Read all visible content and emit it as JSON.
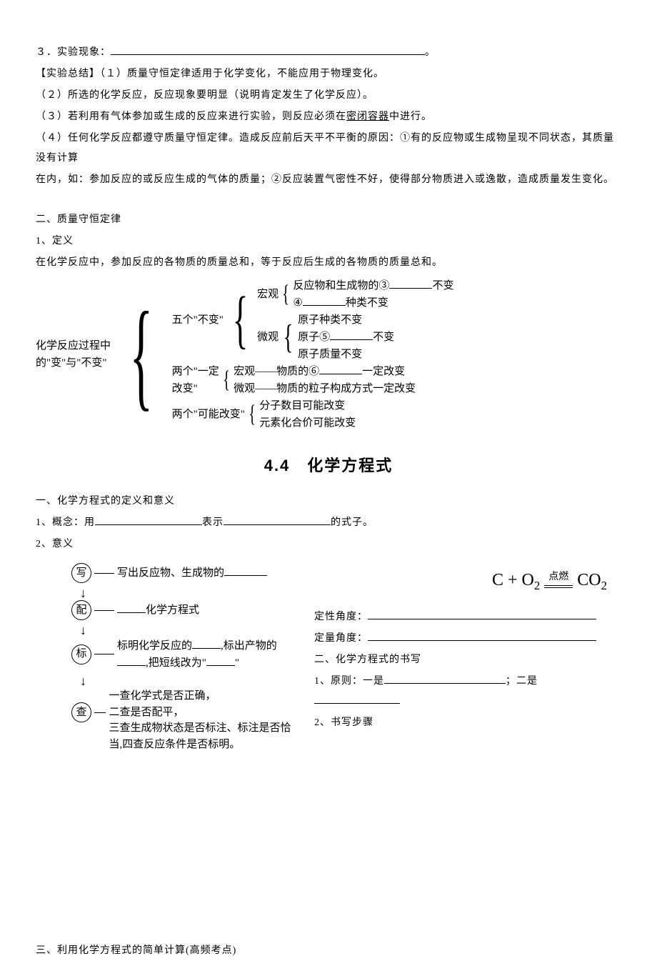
{
  "top": {
    "p3_label": "３．实验现象：",
    "p3_end": "。",
    "summary_1": "【实验总结】（１）质量守恒定律适用于化学变化，不能应用于物理变化。",
    "summary_2": "（２）所选的化学反应，反应现象要明显（说明肯定发生了化学反应）。",
    "summary_3a": "（３）若利用有气体参加或生成的反应来进行实验，则反应必须在",
    "summary_3b": "密闭容器",
    "summary_3c": "中进行。",
    "summary_4a": "（４）任何化学反应都遵守质量守恒定律。造成反应前后天平不平衡的原因：①有的反应物或生成物呈现不同状态，其质量没有计算",
    "summary_4b": "在内，如：参加反应的或反应生成的气体的质量；②反应装置气密性不好，使得部分物质进入或逸散，造成质量发生变化。"
  },
  "sec2": {
    "heading": "二、质量守恒定律",
    "def_label": "1、定义",
    "def_text": "在化学反应中，参加反应的各物质的质量总和，等于反应后生成的各物质的质量总和。"
  },
  "brace": {
    "root1": "化学反应过程中",
    "root2": "的\"变\"与\"不变\"",
    "g1": "五个\"不变\"",
    "g1_macro": "宏观",
    "g1_macro_a1": "反应物和生成物的③",
    "g1_macro_a2": "不变",
    "g1_macro_b1": "④",
    "g1_macro_b2": "种类不变",
    "g1_micro": "微观",
    "g1_micro_a": "原子种类不变",
    "g1_micro_b1": "原子⑤",
    "g1_micro_b2": "不变",
    "g1_micro_c": "原子质量不变",
    "g2a": "两个\"一定",
    "g2b": "改变\"",
    "g2_macro1": "宏观——物质的⑥",
    "g2_macro2": "一定改变",
    "g2_micro": "微观——物质的粒子构成方式一定改变",
    "g3": "两个\"可能改变\"",
    "g3_a": "分子数目可能改变",
    "g3_b": "元素化合价可能改变"
  },
  "title44": "4.4　化学方程式",
  "sec_eq": {
    "h1": "一、化学方程式的定义和意义",
    "p1a": "1、概念：用",
    "p1b": "表示",
    "p1c": "的式子。",
    "p2": "2、意义"
  },
  "flow": {
    "c1": "写",
    "t1a": "写出反应物、生成物的",
    "c2": "配",
    "t2b": "化学方程式",
    "c3": "标",
    "t3a": "标明化学反应的",
    "t3b": ",标出产物的",
    "t3c": ",把短线改为\"",
    "t3d": "\"",
    "c4": "查",
    "t4": "一查化学式是否正确，\n二查是否配平，\n三查生成物状态是否标注、标注是否恰当,四查反应条件是否标明。"
  },
  "right": {
    "eq_c": "C",
    "eq_plus": " + ",
    "eq_o2": "O",
    "eq_cond": "点燃",
    "eq_co2": "CO",
    "qual": "定性角度：",
    "quan": "定量角度：",
    "h2": "二、化学方程式的书写",
    "r1a": "1、原则：一是",
    "r1b": "；二是",
    "r2": "2、书写步骤"
  },
  "bottom": {
    "h3": "三、利用化学方程式的简单计算(高频考点)"
  }
}
